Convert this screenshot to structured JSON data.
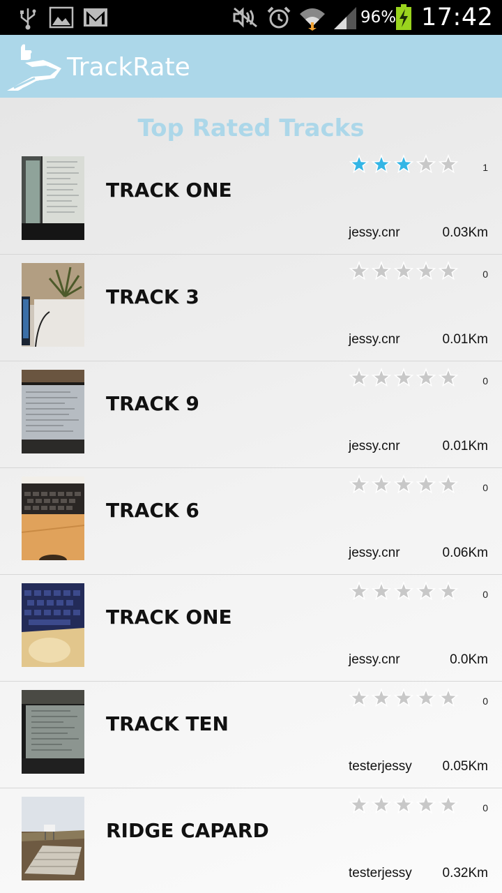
{
  "status_bar": {
    "battery_percent": "96%",
    "time": "17:42",
    "icons": [
      "usb-icon",
      "picture-icon",
      "gmail-icon",
      "mute-icon",
      "alarm-icon",
      "wifi-icon",
      "signal-icon",
      "battery-charging-icon"
    ]
  },
  "app": {
    "title": "TrackRate",
    "logo_icon": "trackrate-logo-icon"
  },
  "list": {
    "title": "Top Rated Tracks",
    "accent_color": "#acd7e9",
    "star_filled_color": "#33b5e5",
    "star_empty_color": "#c8c8c8",
    "items": [
      {
        "name": "TRACK ONE",
        "rating": 3,
        "max_rating": 5,
        "rating_count": "1",
        "user": "jessy.cnr",
        "distance": "0.03Km",
        "thumb": "monitor-photo"
      },
      {
        "name": "TRACK 3",
        "rating": 0,
        "max_rating": 5,
        "rating_count": "0",
        "user": "jessy.cnr",
        "distance": "0.01Km",
        "thumb": "plant-photo"
      },
      {
        "name": "TRACK 9",
        "rating": 0,
        "max_rating": 5,
        "rating_count": "0",
        "user": "jessy.cnr",
        "distance": "0.01Km",
        "thumb": "screen-photo"
      },
      {
        "name": "TRACK 6",
        "rating": 0,
        "max_rating": 5,
        "rating_count": "0",
        "user": "jessy.cnr",
        "distance": "0.06Km",
        "thumb": "keyboard-desk-photo"
      },
      {
        "name": "TRACK ONE",
        "rating": 0,
        "max_rating": 5,
        "rating_count": "0",
        "user": "jessy.cnr",
        "distance": "0.0Km",
        "thumb": "blue-keyboard-photo"
      },
      {
        "name": "TRACK TEN",
        "rating": 0,
        "max_rating": 5,
        "rating_count": "0",
        "user": "testerjessy",
        "distance": "0.05Km",
        "thumb": "dark-screen-photo"
      },
      {
        "name": "RIDGE CAPARD",
        "rating": 0,
        "max_rating": 5,
        "rating_count": "0",
        "user": "testerjessy",
        "distance": "0.32Km",
        "thumb": "field-photo"
      }
    ]
  }
}
